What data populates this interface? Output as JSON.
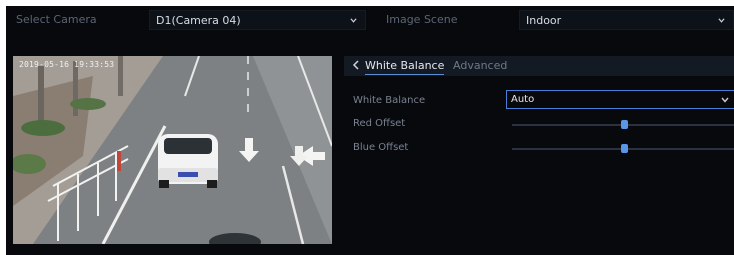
{
  "top_bar": {
    "camera_label": "Select Camera",
    "camera_value": "D1(Camera 04)",
    "scene_label": "Image Scene",
    "scene_value": "Indoor"
  },
  "preview": {
    "timestamp": "2019-05-16 19:33:53"
  },
  "panel": {
    "tabs": [
      {
        "label": "White Balance",
        "active": true
      },
      {
        "label": "Advanced",
        "active": false
      }
    ],
    "white_balance_label": "White Balance",
    "white_balance_value": "Auto",
    "red_offset_label": "Red Offset",
    "red_offset_value": 0.5,
    "blue_offset_label": "Blue Offset",
    "blue_offset_value": 0.5
  },
  "colors": {
    "background": "#07090d",
    "accent": "#5b95e6",
    "label": "#7a8391"
  }
}
